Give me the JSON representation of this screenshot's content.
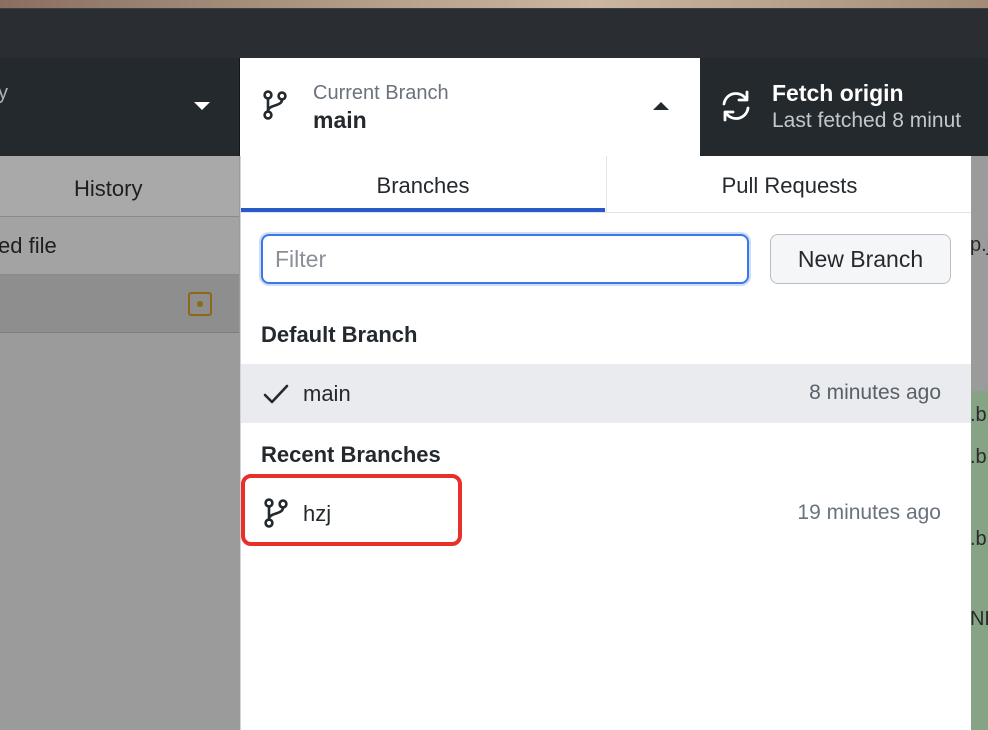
{
  "toolbar": {
    "repository_label_fragment": "y",
    "current_branch": {
      "label": "Current Branch",
      "value": "main"
    },
    "fetch": {
      "title": "Fetch origin",
      "subtitle": "Last fetched 8 minut"
    }
  },
  "left_panel": {
    "history_tab": "History",
    "changed_files_fragment": "ed file"
  },
  "dropdown": {
    "tabs": [
      {
        "label": "Branches"
      },
      {
        "label": "Pull Requests"
      }
    ],
    "filter": {
      "placeholder": "Filter",
      "value": ""
    },
    "new_branch_label": "New Branch",
    "default_section": "Default Branch",
    "recent_section": "Recent Branches",
    "default_branches": [
      {
        "name": "main",
        "time": "8 minutes ago"
      }
    ],
    "recent_branches": [
      {
        "name": "hzj",
        "time": "19 minutes ago"
      }
    ]
  },
  "right_fragments": [
    "p.j",
    ".b",
    ".b",
    ".b",
    "NL"
  ],
  "colors": {
    "accent": "#2859c8",
    "highlight": "#e8302a",
    "toolbar": "#24292e"
  },
  "icons": [
    "git-branch-icon",
    "caret-up-icon",
    "caret-down-icon",
    "sync-icon",
    "check-icon",
    "modified-file-icon"
  ]
}
